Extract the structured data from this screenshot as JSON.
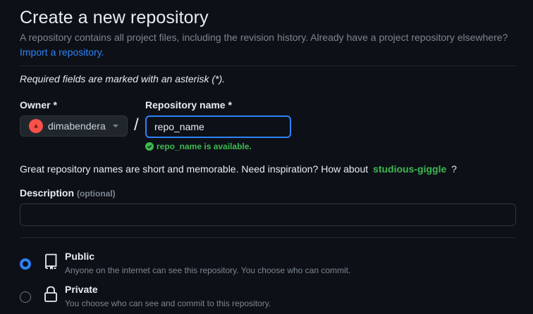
{
  "header": {
    "title": "Create a new repository",
    "subtitle": "A repository contains all project files, including the revision history. Already have a project repository elsewhere?",
    "import_link": "Import a repository."
  },
  "required_note": "Required fields are marked with an asterisk (*).",
  "owner": {
    "label": "Owner *",
    "value": "dimabendera"
  },
  "separator": "/",
  "repo_name": {
    "label": "Repository name *",
    "value": "repo_name",
    "availability": "repo_name is available."
  },
  "inspiration": {
    "text_before": "Great repository names are short and memorable. Need inspiration? How about",
    "suggestion": "studious-giggle",
    "text_after": "?"
  },
  "description": {
    "label": "Description",
    "optional": "(optional)",
    "value": ""
  },
  "visibility": {
    "public": {
      "title": "Public",
      "desc": "Anyone on the internet can see this repository. You choose who can commit.",
      "selected": true
    },
    "private": {
      "title": "Private",
      "desc": "You choose who can see and commit to this repository.",
      "selected": false
    }
  },
  "colors": {
    "background": "#0d1117",
    "accent": "#2f81f7",
    "success": "#3fb950",
    "muted": "#7d8590"
  },
  "icons": {
    "public": "repo-book-icon",
    "private": "lock-icon",
    "available": "check-circle-icon",
    "dropdown": "triangle-down-icon"
  }
}
